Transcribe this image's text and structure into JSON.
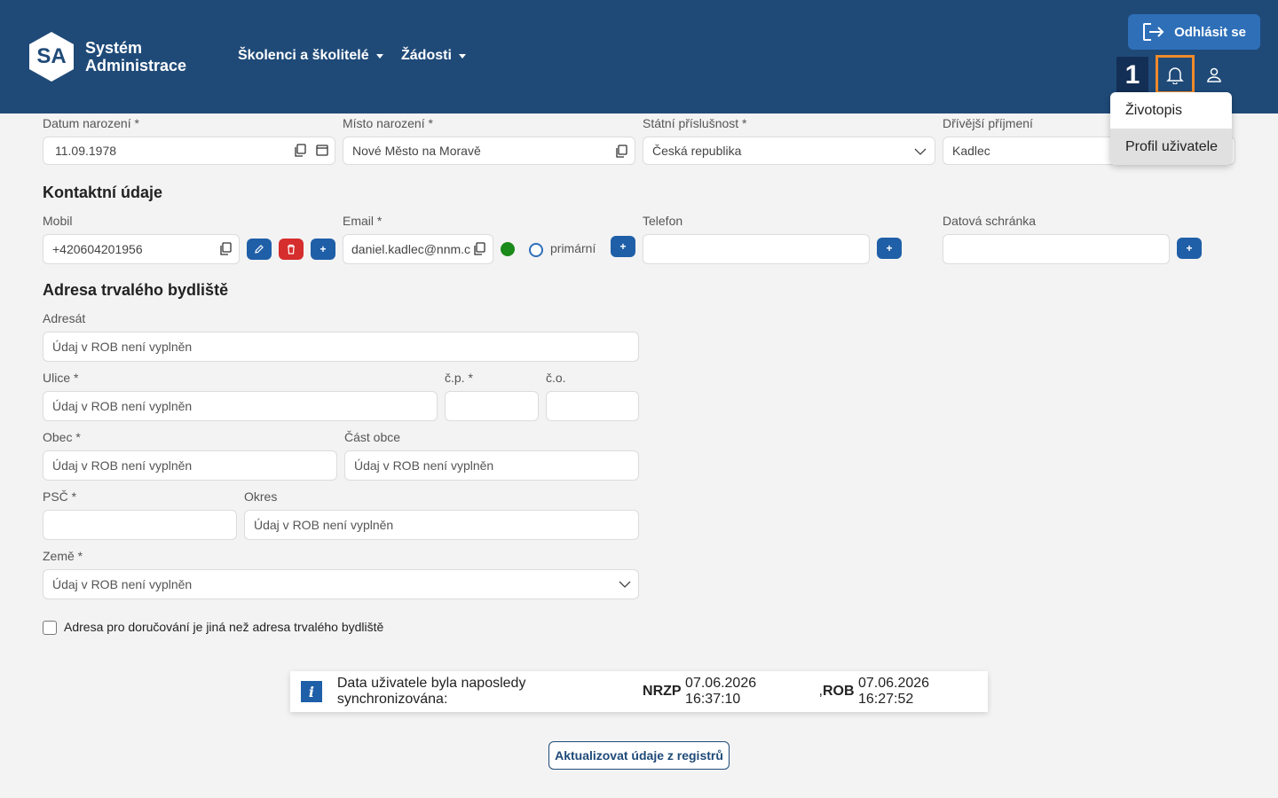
{
  "header": {
    "logo_abbr": "SA",
    "logo_line1": "Systém",
    "logo_line2": "Administrace",
    "nav": [
      "Školenci a školitelé",
      "Žádosti"
    ],
    "logout_label": "Odhlásit se",
    "badge": "1"
  },
  "user_menu": {
    "items": [
      "Životopis",
      "Profil uživatele"
    ],
    "highlighted": "Profil uživatele"
  },
  "personal": {
    "birth_date_label": "Datum narození *",
    "birth_date_value": "11.09.1978",
    "birth_place_label": "Místo narození *",
    "birth_place_value": "Nové Město na Moravě",
    "citizenship_label": "Státní příslušnost *",
    "citizenship_value": "Česká republika",
    "former_surname_label": "Dřívější příjmení",
    "former_surname_value": "Kadlec"
  },
  "contact": {
    "title": "Kontaktní údaje",
    "mobile_label": "Mobil",
    "mobile_value": "+420604201956",
    "email_label": "Email *",
    "email_value": "daniel.kadlec@nnm.c",
    "primary_label": "primární",
    "phone_label": "Telefon",
    "phone_value": "",
    "databox_label": "Datová schránka",
    "databox_value": ""
  },
  "address": {
    "title": "Adresa trvalého bydliště",
    "addressee_label": "Adresát",
    "street_label": "Ulice *",
    "cp_label": "č.p. *",
    "co_label": "č.o.",
    "city_label": "Obec *",
    "city_part_label": "Část obce",
    "zip_label": "PSČ *",
    "district_label": "Okres",
    "country_label": "Země *",
    "placeholder": "Údaj v ROB není vyplněn",
    "delivery_checkbox_label": "Adresa pro doručování je jiná než adresa trvalého bydliště"
  },
  "sync": {
    "prefix": "Data uživatele byla naposledy synchronizována:",
    "nrzp_label": "NRZP",
    "nrzp_time": "07.06.2026 16:37:10",
    "rob_label": "ROB",
    "rob_time": "07.06.2026 16:27:52",
    "update_button": "Aktualizovat údaje z registrů"
  },
  "colors": {
    "header_bg": "#1f4a78",
    "accent": "#1f5fa8",
    "delete": "#d62d2d",
    "highlight": "#ef8a2a",
    "status_green": "#1a8a1a"
  }
}
